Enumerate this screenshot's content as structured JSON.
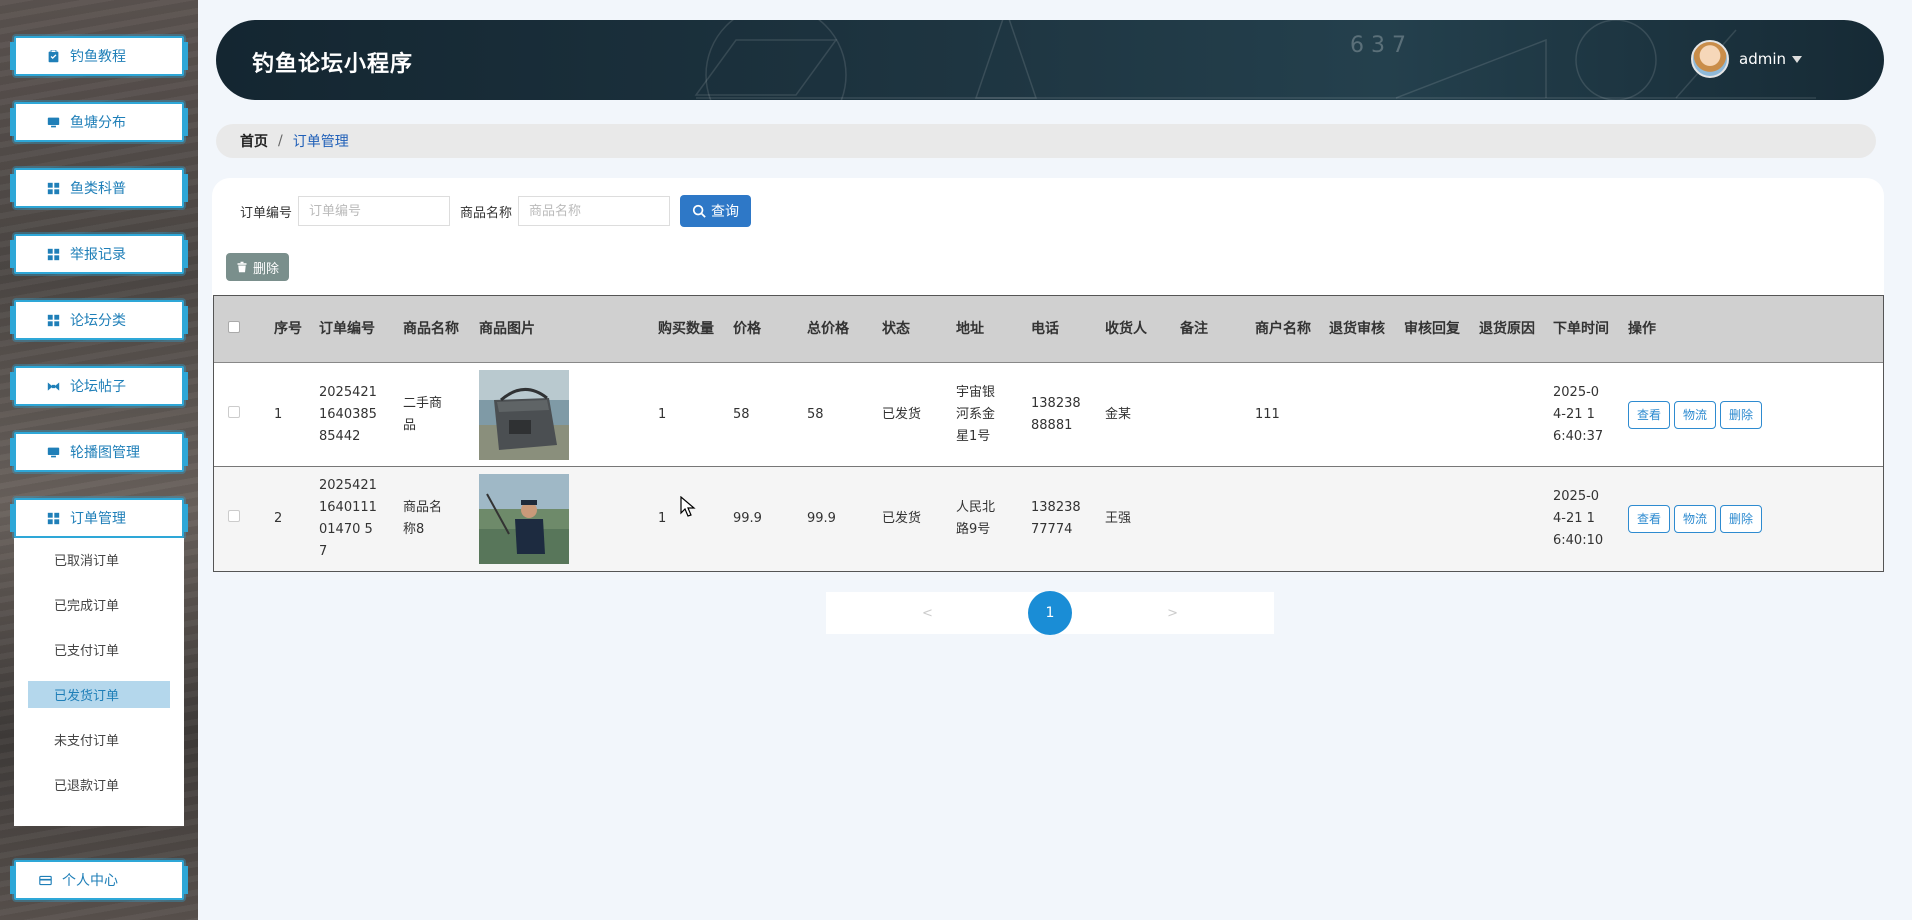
{
  "app": {
    "title": "钓鱼论坛小程序"
  },
  "user": {
    "name": "admin"
  },
  "sidebar": {
    "items": [
      {
        "label": "钓鱼教程",
        "icon": "clipboard-icon"
      },
      {
        "label": "鱼塘分布",
        "icon": "monitor-icon"
      },
      {
        "label": "鱼类科普",
        "icon": "grid-icon"
      },
      {
        "label": "举报记录",
        "icon": "grid-icon"
      },
      {
        "label": "论坛分类",
        "icon": "grid-icon"
      },
      {
        "label": "论坛帖子",
        "icon": "bowtie-icon"
      },
      {
        "label": "轮播图管理",
        "icon": "monitor-icon"
      },
      {
        "label": "订单管理",
        "icon": "grid-icon"
      }
    ],
    "submenu": [
      {
        "label": "已取消订单"
      },
      {
        "label": "已完成订单"
      },
      {
        "label": "已支付订单"
      },
      {
        "label": "已发货订单",
        "active": true
      },
      {
        "label": "未支付订单"
      },
      {
        "label": "已退款订单"
      }
    ],
    "profile": {
      "label": "个人中心",
      "icon": "card-icon"
    }
  },
  "breadcrumb": {
    "home": "首页",
    "separator": "/",
    "current": "订单管理"
  },
  "search": {
    "order_no_label": "订单编号",
    "order_no_placeholder": "订单编号",
    "goods_name_label": "商品名称",
    "goods_name_placeholder": "商品名称",
    "query_label": "查询"
  },
  "toolbar": {
    "delete_label": "删除"
  },
  "table": {
    "headers": {
      "seq": "序号",
      "order_no": "订单编号",
      "goods_name": "商品名称",
      "goods_img": "商品图片",
      "qty": "购买数量",
      "price": "价格",
      "total": "总价格",
      "status": "状态",
      "address": "地址",
      "phone": "电话",
      "receiver": "收货人",
      "note": "备注",
      "shop": "商户名称",
      "return_audit": "退货审核",
      "audit_reply": "审核回复",
      "return_reason": "退货原因",
      "order_time": "下单时间",
      "ops": "操作"
    },
    "rows": [
      {
        "seq": "1",
        "order_no": "2025421164038585442",
        "goods_name": "二手商品",
        "qty": "1",
        "price": "58",
        "total": "58",
        "status": "已发货",
        "address": "宇宙银河系金星1号",
        "phone": "13823888881",
        "receiver": "金某",
        "note": "",
        "shop": "111",
        "return_audit": "",
        "audit_reply": "",
        "return_reason": "",
        "order_time": "2025-04-21 16:40:37"
      },
      {
        "seq": "2",
        "order_no": "2025421164011101470 57",
        "goods_name": "商品名称8",
        "qty": "1",
        "price": "99.9",
        "total": "99.9",
        "status": "已发货",
        "address": "人民北路9号",
        "phone": "13823877774",
        "receiver": "王强",
        "note": "",
        "shop": "",
        "return_audit": "",
        "audit_reply": "",
        "return_reason": "",
        "order_time": "2025-04-21 16:40:10"
      }
    ],
    "row_actions": {
      "view": "查看",
      "logistics": "物流",
      "delete": "删除"
    }
  },
  "pagination": {
    "prev": "<",
    "current": "1",
    "next": ">"
  },
  "colors": {
    "accent": "#2ea7d7",
    "header_bg": "#1e3541",
    "primary_button": "#2e78c7",
    "page_active": "#1a8dd6"
  }
}
